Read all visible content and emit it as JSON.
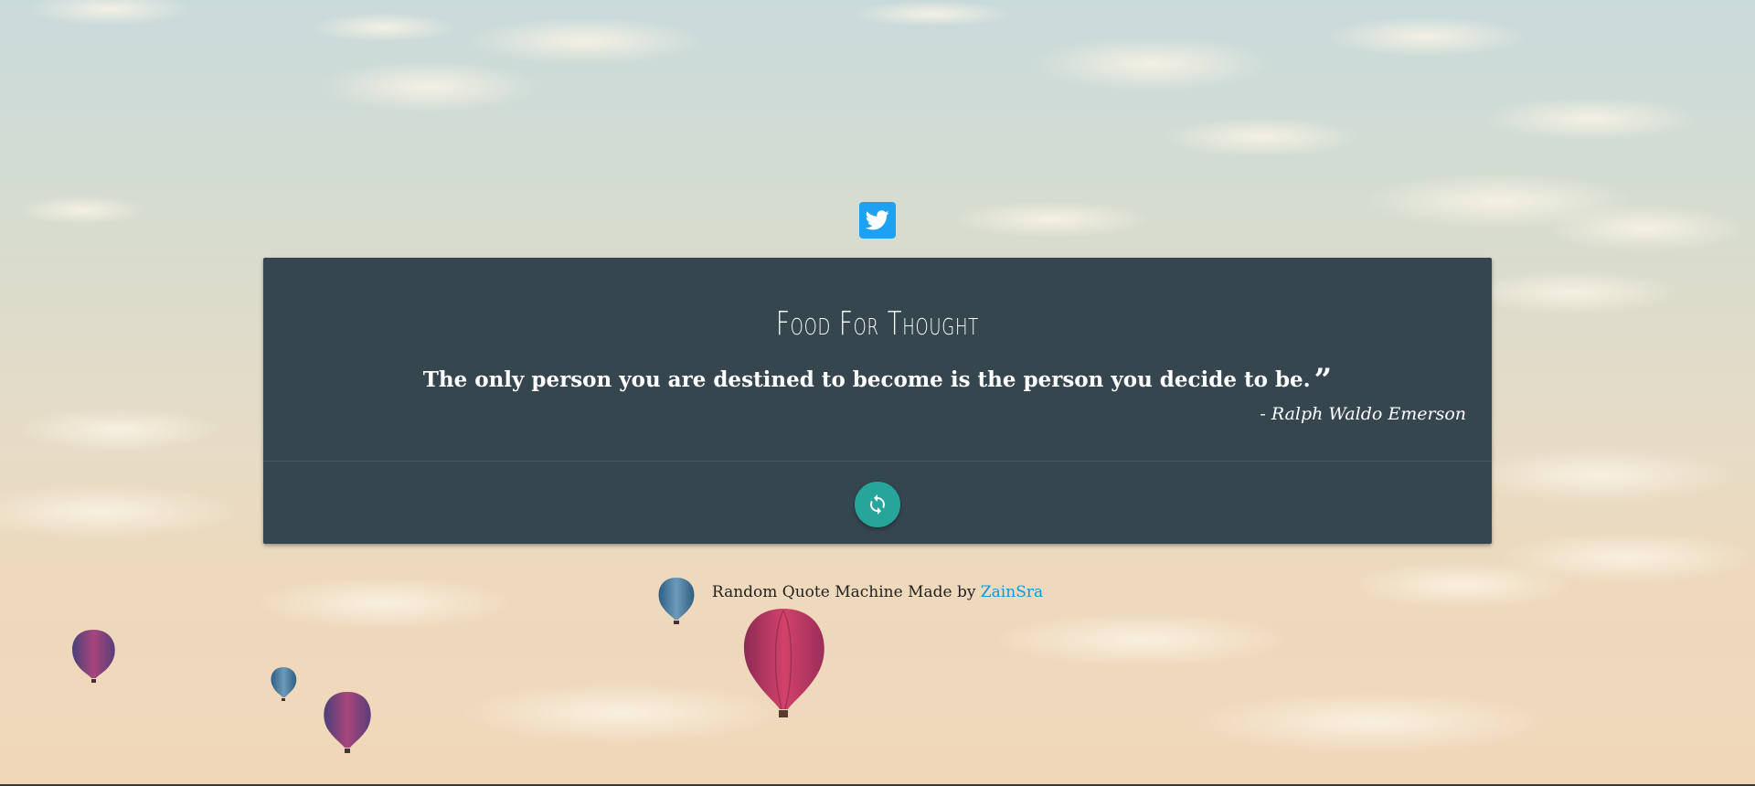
{
  "twitter": {
    "icon": "twitter-icon",
    "color": "#1da1f2"
  },
  "card": {
    "title": "Food For Thought",
    "quote": "The only person you are destined to become is the person you decide to be.",
    "quote_mark": "”",
    "author": "- Ralph Waldo Emerson",
    "background": "#36464f"
  },
  "refresh": {
    "icon": "refresh-icon",
    "color": "#26a69a"
  },
  "footer": {
    "text": "Random Quote Machine Made by ",
    "link_text": "ZainSra",
    "link_color": "#039be5"
  }
}
